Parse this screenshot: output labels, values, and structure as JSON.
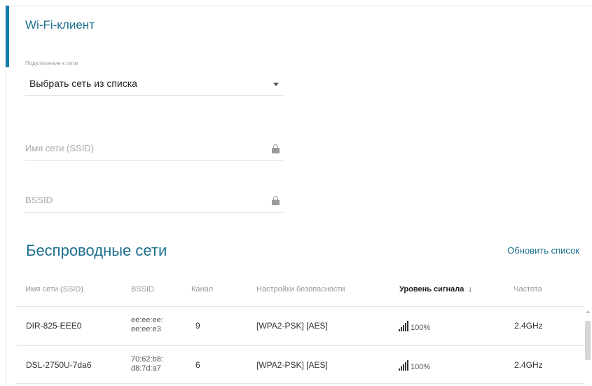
{
  "client": {
    "title": "Wi-Fi-клиент",
    "connection_label": "Подключение к сети",
    "connection_value": "Выбрать сеть из списка",
    "ssid_placeholder": "Имя сети (SSID)",
    "bssid_placeholder": "BSSID"
  },
  "wireless": {
    "title": "Беспроводные сети",
    "refresh_label": "Обновить список",
    "columns": [
      "Имя сети (SSID)",
      "BSSID",
      "Канал",
      "Настройки безопасности",
      "Уровень сигнала",
      "Частота"
    ],
    "sorted_column_index": 4,
    "sort_arrow": "↓",
    "rows": [
      {
        "ssid": "DIR-825-EEE0",
        "bssid_1": "ee:ee:ee:",
        "bssid_2": "ee:ee:e3",
        "channel": "9",
        "security": "[WPA2-PSK] [AES]",
        "signal": "100%",
        "frequency": "2.4GHz"
      },
      {
        "ssid": "DSL-2750U-7da6",
        "bssid_1": "70:62:b8:",
        "bssid_2": "d8:7d:a7",
        "channel": "6",
        "security": "[WPA2-PSK] [AES]",
        "signal": "100%",
        "frequency": "2.4GHz"
      }
    ]
  },
  "colors": {
    "accent": "#0f7ea8",
    "title": "#1b6f8e"
  },
  "icons": {
    "lock": "lock-icon",
    "caret": "chevron-down-icon",
    "signal": "signal-strength-icon",
    "sort": "sort-arrow-icon"
  }
}
